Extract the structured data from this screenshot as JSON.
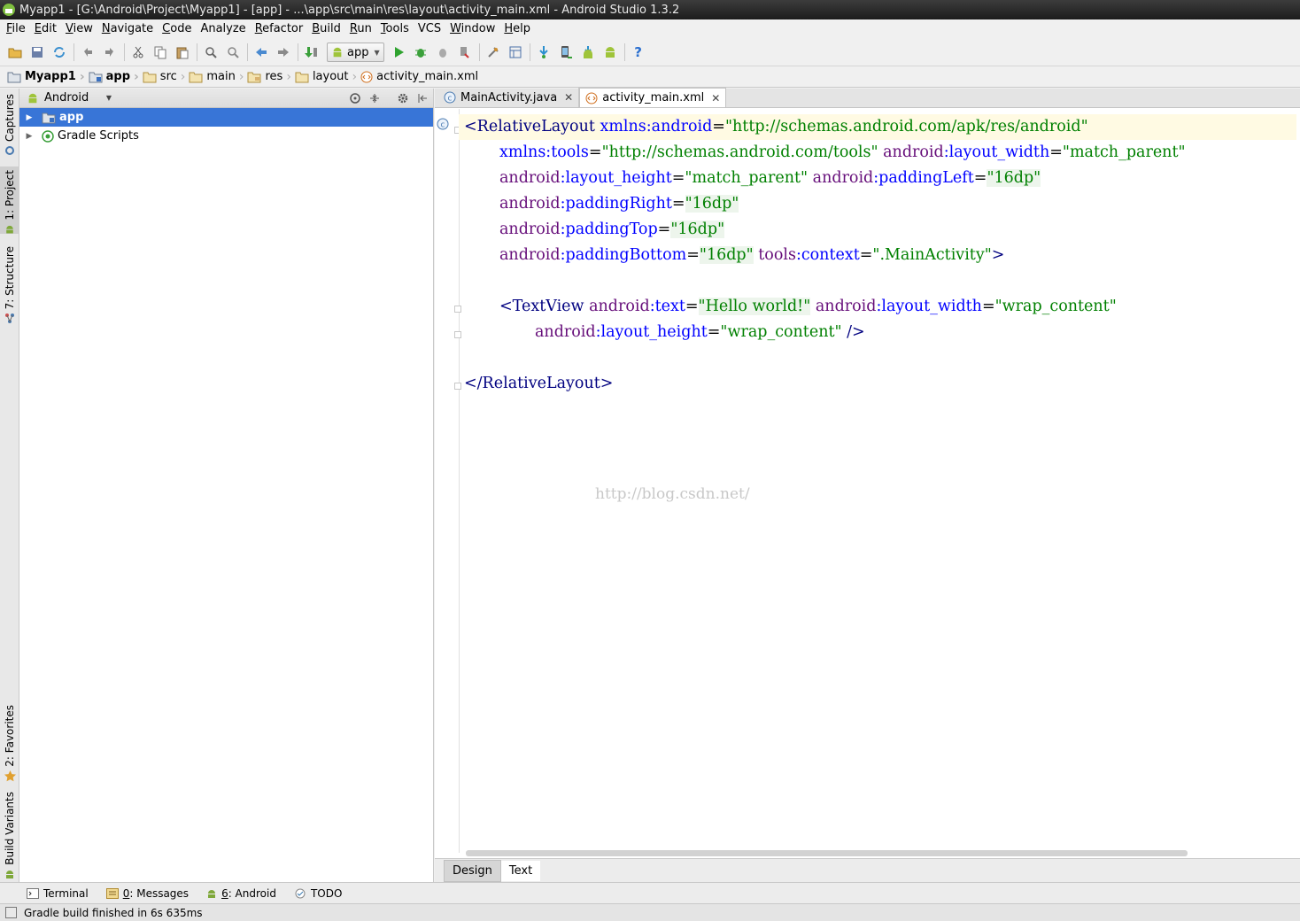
{
  "window": {
    "title": "Myapp1 - [G:\\Android\\Project\\Myapp1] - [app] - ...\\app\\src\\main\\res\\layout\\activity_main.xml - Android Studio 1.3.2"
  },
  "menu": [
    {
      "label": "File",
      "u": "F",
      "rest": "ile"
    },
    {
      "label": "Edit",
      "u": "E",
      "rest": "dit"
    },
    {
      "label": "View",
      "u": "V",
      "rest": "iew"
    },
    {
      "label": "Navigate",
      "u": "N",
      "rest": "avigate"
    },
    {
      "label": "Code",
      "u": "C",
      "rest": "ode"
    },
    {
      "label": "Analyze",
      "u": "",
      "rest": "Analyze"
    },
    {
      "label": "Refactor",
      "u": "R",
      "rest": "efactor"
    },
    {
      "label": "Build",
      "u": "B",
      "rest": "uild"
    },
    {
      "label": "Run",
      "u": "R",
      "rest": "un"
    },
    {
      "label": "Tools",
      "u": "T",
      "rest": "ools"
    },
    {
      "label": "VCS",
      "u": "",
      "rest": "VCS"
    },
    {
      "label": "Window",
      "u": "W",
      "rest": "indow"
    },
    {
      "label": "Help",
      "u": "H",
      "rest": "elp"
    }
  ],
  "toolbar": {
    "run_config": "app"
  },
  "breadcrumb": [
    "Myapp1",
    "app",
    "src",
    "main",
    "res",
    "layout",
    "activity_main.xml"
  ],
  "left_strip": {
    "captures": "Captures",
    "project": "1: Project",
    "structure": "7: Structure",
    "favorites": "2: Favorites",
    "build_variants": "Build Variants"
  },
  "project_panel": {
    "view_mode": "Android",
    "tree": [
      {
        "label": "app",
        "selected": true
      },
      {
        "label": "Gradle Scripts",
        "selected": false
      }
    ]
  },
  "editor": {
    "tabs": [
      {
        "label": "MainActivity.java",
        "active": false
      },
      {
        "label": "activity_main.xml",
        "active": true
      }
    ],
    "watermark": "http://blog.csdn.net/",
    "mode_tabs": {
      "design": "Design",
      "text": "Text"
    }
  },
  "code": {
    "l1_tag": "<RelativeLayout",
    "l1_attr": "xmlns:android",
    "l1_val": "\"http://schemas.android.com/apk/res/android\"",
    "l2_attr1": "xmlns:tools",
    "l2_val1": "\"http://schemas.android.com/tools\"",
    "l2_ns": "android",
    "l2_attr2": ":layout_width",
    "l2_val2": "\"match_parent\"",
    "l3_ns1": "android",
    "l3_attr1": ":layout_height",
    "l3_val1": "\"match_parent\"",
    "l3_ns2": "android",
    "l3_attr2": ":paddingLeft",
    "l3_val2": "\"16dp\"",
    "l4_ns": "android",
    "l4_attr": ":paddingRight",
    "l4_val": "\"16dp\"",
    "l5_ns": "android",
    "l5_attr": ":paddingTop",
    "l5_val": "\"16dp\"",
    "l6_ns": "android",
    "l6_attr": ":paddingBottom",
    "l6_val": "\"16dp\"",
    "l6_ns2": "tools",
    "l6_attr2": ":context",
    "l6_val2": "\".MainActivity\"",
    "l6_end": ">",
    "l8_tag": "<TextView",
    "l8_ns1": "android",
    "l8_attr1": ":text",
    "l8_val1": "\"Hello world!\"",
    "l8_ns2": "android",
    "l8_attr2": ":layout_width",
    "l8_val2": "\"wrap_content\"",
    "l9_ns": "android",
    "l9_attr": ":layout_height",
    "l9_val": "\"wrap_content\"",
    "l9_end": " />",
    "l11_tag": "</RelativeLayout>"
  },
  "tool_windows": [
    {
      "num": "",
      "label": "Terminal"
    },
    {
      "num": "0",
      "label": ": Messages"
    },
    {
      "num": "6",
      "label": ": Android"
    },
    {
      "num": "",
      "label": "TODO"
    }
  ],
  "status": {
    "text": "Gradle build finished in 6s 635ms"
  },
  "colors": {
    "selection": "#3875d7",
    "xml_tag": "#000080",
    "xml_attr": "#0000ff",
    "xml_value": "#008000",
    "xml_namespace": "#660e7a"
  }
}
